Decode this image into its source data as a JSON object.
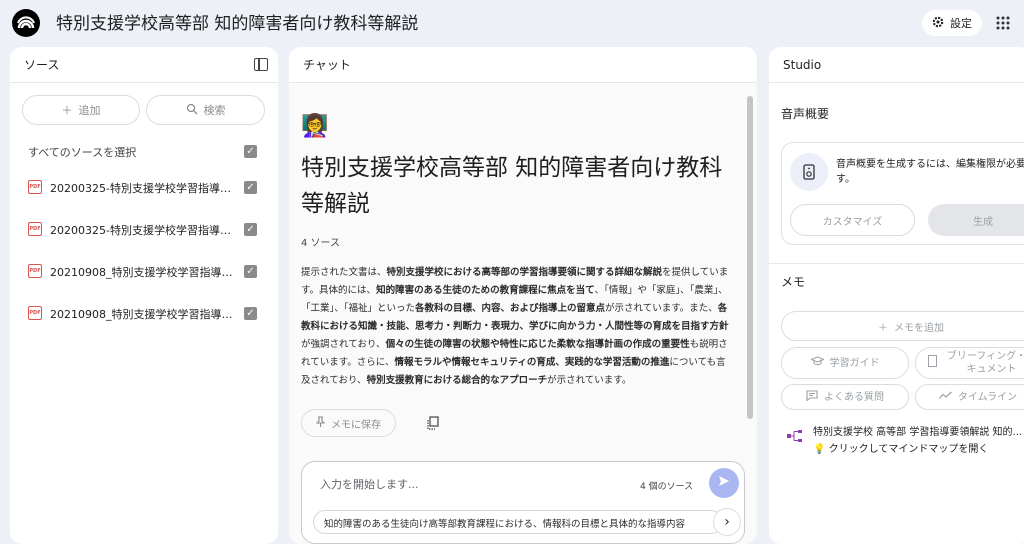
{
  "header": {
    "title": "特別支援学校高等部 知的障害者向け教科等解説",
    "settings_label": "設定"
  },
  "sources": {
    "heading": "ソース",
    "add_label": "追加",
    "search_label": "検索",
    "select_all_label": "すべてのソースを選択",
    "items": [
      {
        "name": "20200325-特別支援学校学習指導要..."
      },
      {
        "name": "20200325-特別支援学校学習指導要..."
      },
      {
        "name": "20210908_特別支援学校学習指導要..."
      },
      {
        "name": "20210908_特別支援学校学習指導要..."
      }
    ],
    "pdf_badge": "PDF"
  },
  "chat": {
    "heading": "チャット",
    "emoji": "👩‍🏫",
    "title": "特別支援学校高等部 知的障害者向け教科等解説",
    "source_count": "4 ソース",
    "summary_parts": [
      {
        "t": "提示された文書は、",
        "b": false
      },
      {
        "t": "特別支援学校における高等部の学習指導要領に関する詳細な解説",
        "b": true
      },
      {
        "t": "を提供しています。具体的には、",
        "b": false
      },
      {
        "t": "知的障害のある生徒のための教育課程に焦点を当て",
        "b": true
      },
      {
        "t": "、「情報」や「家庭」、「農業」、「工業」、「福祉」といった",
        "b": false
      },
      {
        "t": "各教科の目標、内容、および指導上の留意点",
        "b": true
      },
      {
        "t": "が示されています。また、",
        "b": false
      },
      {
        "t": "各教科における知識・技能、思考力・判断力・表現力、学びに向かう力・人間性等の育成を目指す方針",
        "b": true
      },
      {
        "t": "が強調されており、",
        "b": false
      },
      {
        "t": "個々の生徒の障害の状態や特性に応じた柔軟な指導計画の作成の重要性",
        "b": true
      },
      {
        "t": "も説明されています。さらに、",
        "b": false
      },
      {
        "t": "情報モラルや情報セキュリティの育成、実践的な学習活動の推進",
        "b": true
      },
      {
        "t": "についても言及されており、",
        "b": false
      },
      {
        "t": "特別支援教育における総合的なアプローチ",
        "b": true
      },
      {
        "t": "が示されています。",
        "b": false
      }
    ],
    "save_memo_label": "メモに保存",
    "input_placeholder": "入力を開始します...",
    "input_source_count": "4 個のソース",
    "suggestion": "知的障害のある生徒向け高等部教育課程における、情報科の目標と具体的な指導内容"
  },
  "studio": {
    "heading": "Studio",
    "audio_heading": "音声概要",
    "audio_note": "音声概要を生成するには、編集権限が必要です。",
    "customize_label": "カスタマイズ",
    "generate_label": "生成",
    "memo_heading": "メモ",
    "add_memo_label": "メモを追加",
    "tools": {
      "study_guide": "学習ガイド",
      "briefing": "ブリーフィング・ドキュメント",
      "faq": "よくある質問",
      "timeline": "タイムライン"
    },
    "mindmap_title": "特別支援学校 高等部 学習指導要領解説 知的...",
    "mindmap_hint": "💡 クリックしてマインドマップを開く"
  },
  "colors": {
    "background": "#eef0f8",
    "send_button": "#aab6f2",
    "pdf_icon": "#d9534f"
  }
}
